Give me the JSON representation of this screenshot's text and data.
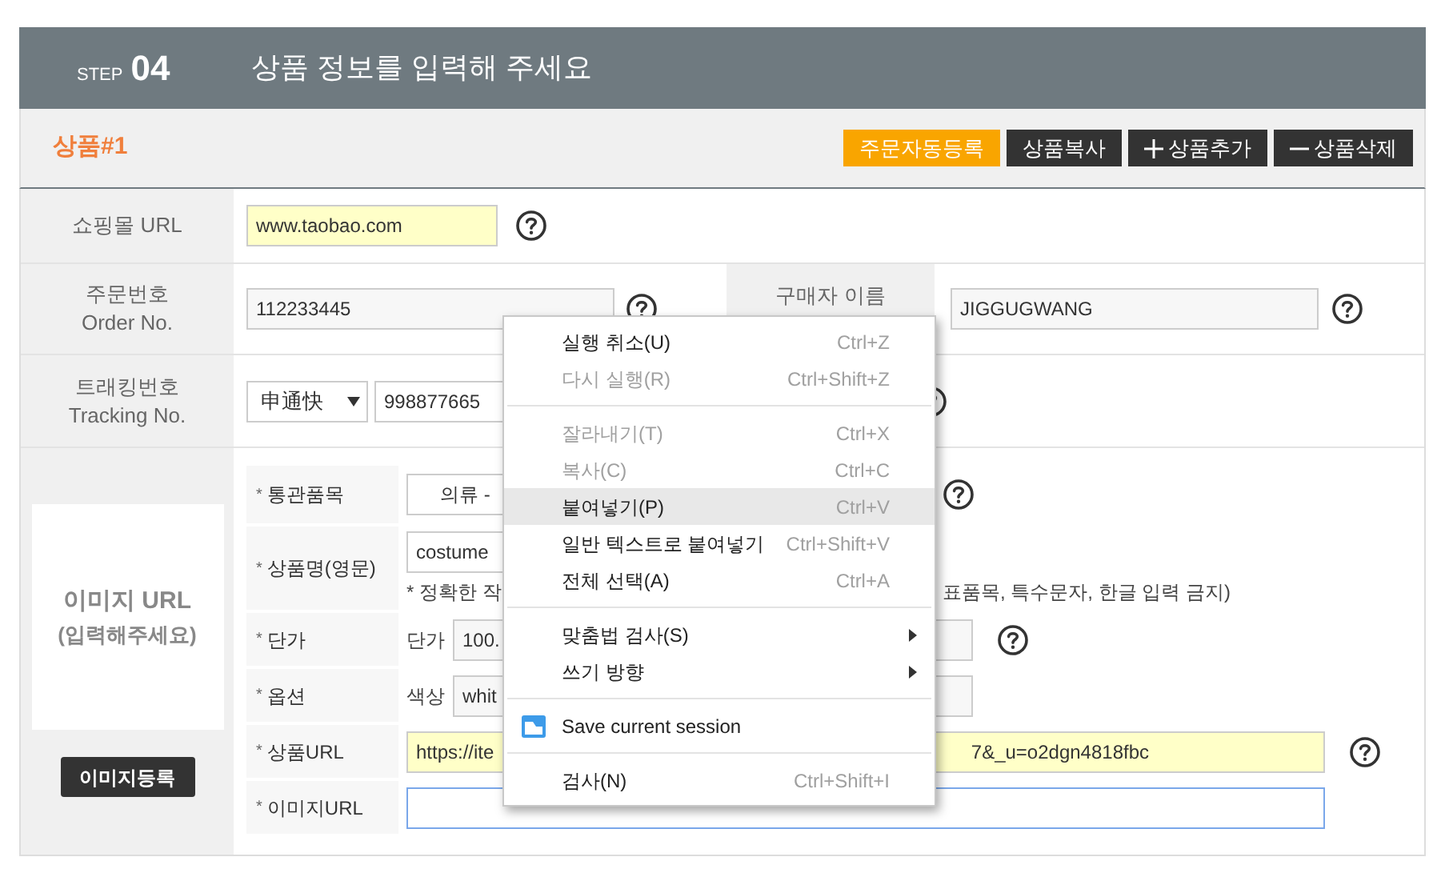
{
  "header": {
    "step_label": "STEP",
    "step_number": "04",
    "title": "상품 정보를 입력해 주세요"
  },
  "product": {
    "title": "상품#1",
    "buttons": [
      {
        "label": "주문자동등록",
        "kind": "primary"
      },
      {
        "label": "상품복사",
        "kind": "plain"
      },
      {
        "label": "상품추가",
        "kind": "add"
      },
      {
        "label": "상품삭제",
        "kind": "remove"
      }
    ]
  },
  "shopping_mall": {
    "label": "쇼핑몰 URL",
    "value": "www.taobao.com",
    "highlighted": true
  },
  "order": {
    "label": "주문번호",
    "label_en": "Order No.",
    "value": "112233445"
  },
  "buyer": {
    "label": "구매자 이름",
    "value": "JIGGUGWANG"
  },
  "tracking": {
    "label": "트래킹번호",
    "label_en": "Tracking No.",
    "carrier": "申通快",
    "value": "998877665"
  },
  "image_box": {
    "title": "이미지 URL",
    "hint": "(입력해주세요)",
    "button": "이미지등록"
  },
  "details": [
    {
      "mark": "*",
      "label": "통관품목",
      "kind": "select",
      "value": "의류 -",
      "help": true
    },
    {
      "mark": "*",
      "label": "상품명(영문)",
      "kind": "text",
      "value": "costume",
      "note": "* 정확한 작",
      "note_end": "표품목, 특수문자, 한글 입력 금지)",
      "help": false
    },
    {
      "mark": "*",
      "label": "단가",
      "kind": "prefixed",
      "prefix": "단가",
      "value": "100.",
      "help": true
    },
    {
      "mark": "*",
      "label": "옵션",
      "kind": "prefixed",
      "prefix": "색상",
      "value": "whit",
      "help": false
    },
    {
      "mark": "*",
      "label": "상품URL",
      "kind": "text",
      "value": "https://ite",
      "value_end": "7&_u=o2dgn4818fbc",
      "highlighted": true,
      "help": true
    },
    {
      "mark": "*",
      "label": "이미지URL",
      "kind": "text",
      "focused": true,
      "help": false
    }
  ],
  "context_menu": [
    {
      "kind": "item",
      "label": "실행 취소(U)",
      "shortcut": "Ctrl+Z",
      "disabled": false,
      "selected": false
    },
    {
      "kind": "item",
      "label": "다시 실행(R)",
      "shortcut": "Ctrl+Shift+Z",
      "disabled": true,
      "selected": false
    },
    {
      "kind": "separator"
    },
    {
      "kind": "item",
      "label": "잘라내기(T)",
      "shortcut": "Ctrl+X",
      "disabled": true,
      "selected": false
    },
    {
      "kind": "item",
      "label": "복사(C)",
      "shortcut": "Ctrl+C",
      "disabled": true,
      "selected": false
    },
    {
      "kind": "item",
      "label": "붙여넣기(P)",
      "shortcut": "Ctrl+V",
      "disabled": false,
      "selected": true
    },
    {
      "kind": "item",
      "label": "일반 텍스트로 붙여넣기",
      "shortcut": "Ctrl+Shift+V",
      "disabled": false,
      "selected": false
    },
    {
      "kind": "item",
      "label": "전체 선택(A)",
      "shortcut": "Ctrl+A",
      "disabled": false,
      "selected": false
    },
    {
      "kind": "separator"
    },
    {
      "kind": "submenu",
      "label": "맞춤법 검사(S)",
      "disabled": false,
      "selected": false
    },
    {
      "kind": "submenu",
      "label": "쓰기 방향",
      "disabled": false,
      "selected": false
    },
    {
      "kind": "separator"
    },
    {
      "kind": "extension",
      "label": "Save current session",
      "disabled": false,
      "selected": false
    },
    {
      "kind": "separator"
    },
    {
      "kind": "item",
      "label": "검사(N)",
      "shortcut": "Ctrl+Shift+I",
      "disabled": false,
      "selected": false
    }
  ]
}
